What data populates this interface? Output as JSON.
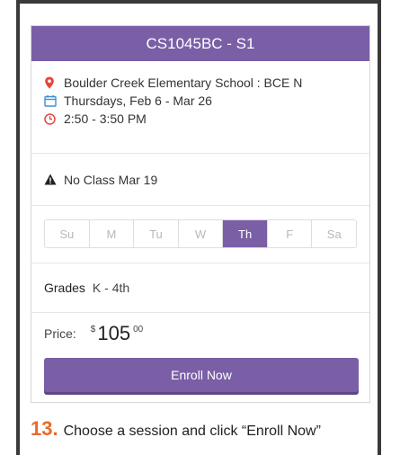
{
  "session": {
    "title": "CS1045BC - S1",
    "location": "Boulder Creek Elementary School : BCE N",
    "dates": "Thursdays, Feb 6 - Mar 26",
    "time": "2:50 - 3:50 PM",
    "notice": "No Class Mar 19",
    "days": [
      "Su",
      "M",
      "Tu",
      "W",
      "Th",
      "F",
      "Sa"
    ],
    "active_day": "Th",
    "grades_label": "Grades",
    "grades_value": "K - 4th",
    "price_label": "Price:",
    "price_currency": "$",
    "price_whole": "105",
    "price_cents": "00",
    "enroll_label": "Enroll Now"
  },
  "caption": {
    "step": "13.",
    "text": "Choose a session and click “Enroll Now”"
  },
  "colors": {
    "accent": "#7a5fa6",
    "icon_red": "#e8453c",
    "icon_blue": "#3b8fd6",
    "step_orange": "#e86b2b"
  }
}
